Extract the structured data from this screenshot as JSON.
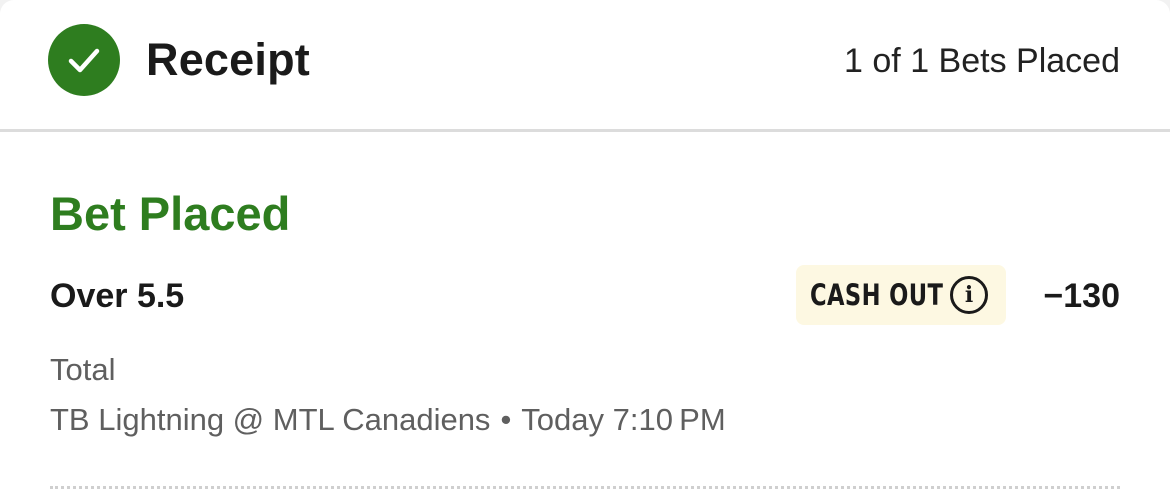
{
  "header": {
    "title": "Receipt",
    "bets_count": "1 of 1 Bets Placed",
    "status_icon": "check-circle-icon",
    "accent_color": "#2e7d1f"
  },
  "bet": {
    "status": "Bet Placed",
    "selection": "Over 5.5",
    "cash_out_label": "CASH OUT",
    "info_icon": "info-icon",
    "odds": "−130",
    "market": "Total",
    "matchup": "TB Lightning @ MTL Canadiens",
    "separator": "•",
    "start_time": "Today 7:10 PM"
  }
}
